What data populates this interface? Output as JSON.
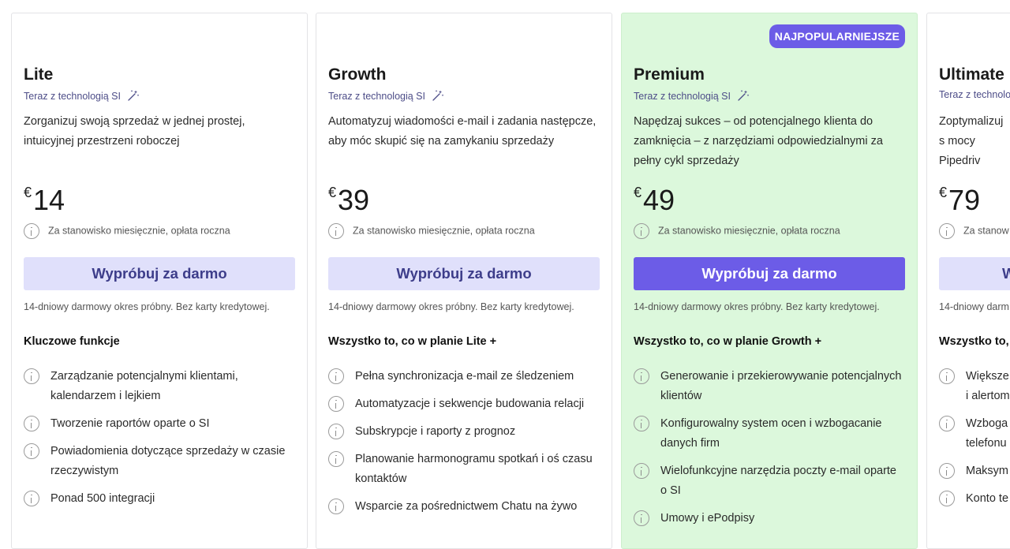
{
  "plans": [
    {
      "name": "Lite",
      "ai_tag": "Teraz z technologią SI",
      "description": "Zorganizuj swoją sprzedaż w jednej prostej, intuicyjnej przestrzeni roboczej",
      "currency": "€",
      "price": "14",
      "per_seat": "Za stanowisko miesięcznie, opłata roczna",
      "cta": "Wypróbuj za darmo",
      "trial": "14-dniowy darmowy okres próbny. Bez karty kredytowej.",
      "features_heading": "Kluczowe funkcje",
      "features": [
        "Zarządzanie potencjalnymi klientami, kalendarzem i lejkiem",
        "Tworzenie raportów oparte o SI",
        "Powiadomienia dotyczące sprzedaży w czasie rzeczywistym",
        "Ponad 500 integracji"
      ]
    },
    {
      "name": "Growth",
      "ai_tag": "Teraz z technologią SI",
      "description": "Automatyzuj wiadomości e-mail i zadania następcze, aby móc skupić się na zamykaniu sprzedaży",
      "currency": "€",
      "price": "39",
      "per_seat": "Za stanowisko miesięcznie, opłata roczna",
      "cta": "Wypróbuj za darmo",
      "trial": "14-dniowy darmowy okres próbny. Bez karty kredytowej.",
      "features_heading": "Wszystko to, co w planie Lite +",
      "features": [
        "Pełna synchronizacja e-mail ze śledzeniem",
        "Automatyzacje i sekwencje budowania relacji",
        "Subskrypcje i raporty z prognoz",
        "Planowanie harmonogramu spotkań i oś czasu kontaktów",
        "Wsparcie za pośrednictwem Chatu na żywo"
      ]
    },
    {
      "name": "Premium",
      "badge": "NAJPOPULARNIEJSZE",
      "ai_tag": "Teraz z technologią SI",
      "description": "Napędzaj sukces – od potencjalnego klienta do zamknięcia – z narzędziami odpowiedzialnymi za pełny cykl sprzedaży",
      "currency": "€",
      "price": "49",
      "per_seat": "Za stanowisko miesięcznie, opłata roczna",
      "cta": "Wypróbuj za darmo",
      "trial": "14-dniowy darmowy okres próbny. Bez karty kredytowej.",
      "features_heading": "Wszystko to, co w planie Growth +",
      "features": [
        "Generowanie i przekierowywanie potencjalnych klientów",
        "Konfigurowalny system ocen i wzbogacanie danych firm",
        "Wielofunkcyjne narzędzia poczty e-mail oparte o SI",
        "Umowy i ePodpisy"
      ]
    },
    {
      "name": "Ultimate",
      "ai_tag": "Teraz z technolo",
      "description": "Zoptymalizuj s mocy Pipedriv",
      "currency": "€",
      "price": "79",
      "per_seat": "Za stanow",
      "cta": "W",
      "trial": "14-dniowy darm",
      "features_heading": "Wszystko to,",
      "features": [
        "Większe i alertom",
        "Wzboga telefonu",
        "Maksym",
        "Konto te"
      ]
    }
  ],
  "colors": {
    "accent": "#6c5ce7",
    "popular_bg": "#dcf8dc",
    "cta_light_bg": "#e0e0fb",
    "cta_light_text": "#3d3d8a",
    "ai_tag_text": "#4d4d88"
  }
}
